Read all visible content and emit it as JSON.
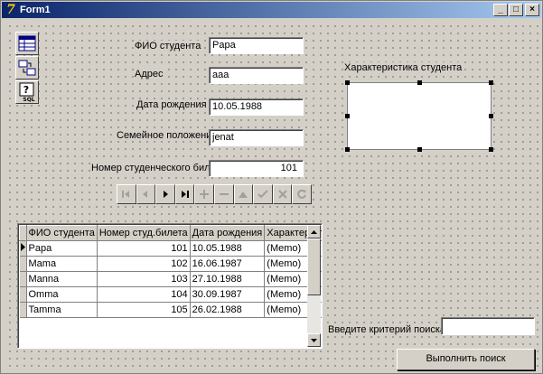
{
  "window": {
    "title": "Form1"
  },
  "toolbar_icons": [
    "table-icon",
    "import-export-icon",
    "sql-query-icon"
  ],
  "form": {
    "fio_label": "ФИО студента",
    "fio_value": "Papa",
    "address_label": "Адрес",
    "address_value": "aaa",
    "birth_label": "Дата рождения",
    "birth_value": "10.05.1988",
    "marital_label": "Семейное положение",
    "marital_value": "jenat",
    "card_label": "Номер студенческого билета",
    "card_value": "101",
    "memo_label": "Характеристика студента"
  },
  "navigator": [
    "first",
    "prior",
    "next",
    "last",
    "insert",
    "delete",
    "edit",
    "post",
    "cancel",
    "refresh"
  ],
  "grid": {
    "columns": [
      "ФИО студента",
      "Номер студ.билета",
      "Дата рождения",
      "Характеристика"
    ],
    "rows": [
      [
        "Papa",
        "101",
        "10.05.1988",
        "(Memo)"
      ],
      [
        "Mama",
        "102",
        "16.06.1987",
        "(Memo)"
      ],
      [
        "Manna",
        "103",
        "27.10.1988",
        "(Memo)"
      ],
      [
        "Omma",
        "104",
        "30.09.1987",
        "(Memo)"
      ],
      [
        "Tamma",
        "105",
        "26.02.1988",
        "(Memo)"
      ]
    ]
  },
  "search": {
    "label": "Введите  критерий поиска",
    "value": "",
    "button_label": "Выполнить поиск"
  }
}
